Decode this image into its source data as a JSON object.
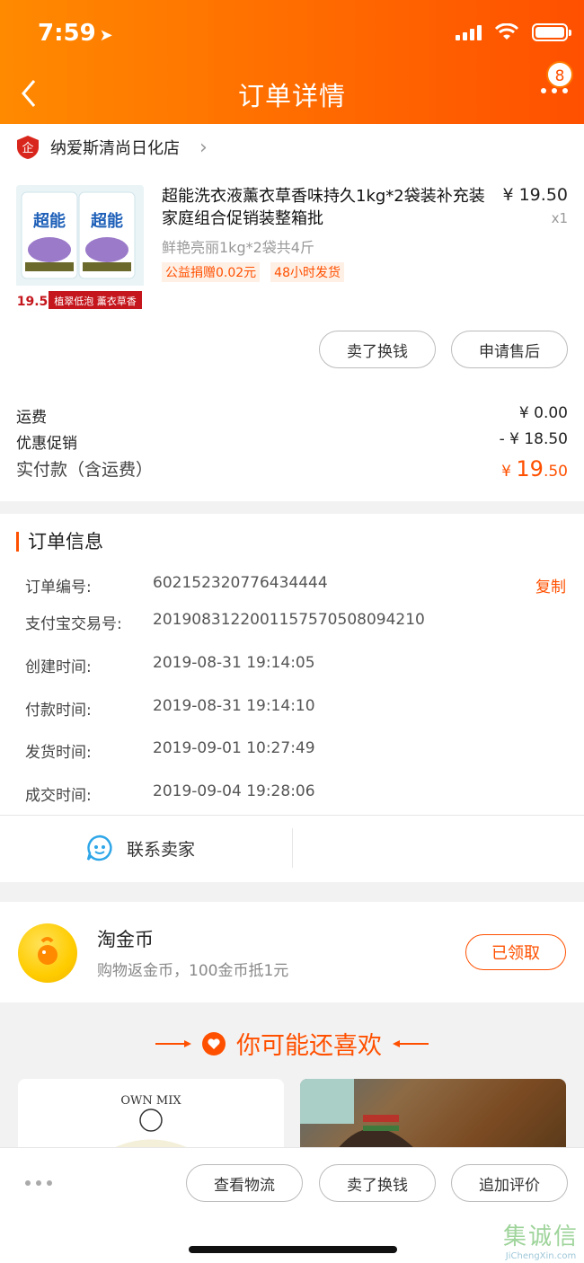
{
  "status_bar": {
    "time": "7:59"
  },
  "header": {
    "title": "订单详情",
    "badge_count": "8"
  },
  "shop": {
    "name": "纳爱斯清尚日化店"
  },
  "product": {
    "title": "超能洗衣液薰衣草香味持久1kg*2袋装补充装家庭组合促销装整箱批",
    "price": "¥ 19.50",
    "qty": "x1",
    "spec": "鲜艳亮丽1kg*2袋共4斤",
    "tags": [
      "公益捐赠0.02元",
      "48小时发货"
    ],
    "image_price": "19.5",
    "image_caption": "植翠低泡 薰衣草香",
    "brand_text": "超能"
  },
  "order_actions": {
    "sell_label": "卖了换钱",
    "aftersale_label": "申请售后"
  },
  "fees": {
    "shipping_label": "运费",
    "shipping_value": "¥ 0.00",
    "discount_label": "优惠促销",
    "discount_value": "- ¥ 18.50",
    "total_label": "实付款（含运费）",
    "total_currency": "¥ ",
    "total_int": "19",
    "total_dec": ".50"
  },
  "order_info": {
    "title": "订单信息",
    "copy_label": "复制",
    "rows": [
      {
        "k": "订单编号:",
        "v": "602152320776434444"
      },
      {
        "k": "支付宝交易号:",
        "v": "2019083122001157570508094210"
      },
      {
        "k": "创建时间:",
        "v": "2019-08-31 19:14:05"
      },
      {
        "k": "付款时间:",
        "v": "2019-08-31 19:14:10"
      },
      {
        "k": "发货时间:",
        "v": "2019-09-01 10:27:49"
      },
      {
        "k": "成交时间:",
        "v": "2019-09-04 19:28:06"
      }
    ],
    "contact_label": "联系卖家"
  },
  "coin": {
    "title": "淘金币",
    "subtitle": "购物返金币，100金币抵1元",
    "button": "已领取"
  },
  "recommend": {
    "title": "你可能还喜欢",
    "left_item_text": "OWN MIX"
  },
  "bottom_bar": {
    "logistics": "查看物流",
    "sell": "卖了换钱",
    "review": "追加评价"
  },
  "watermark": {
    "cn": "集诚信",
    "en": "JiChengXin.com"
  },
  "colors": {
    "accent": "#ff5000",
    "header_start": "#ff8a00"
  }
}
